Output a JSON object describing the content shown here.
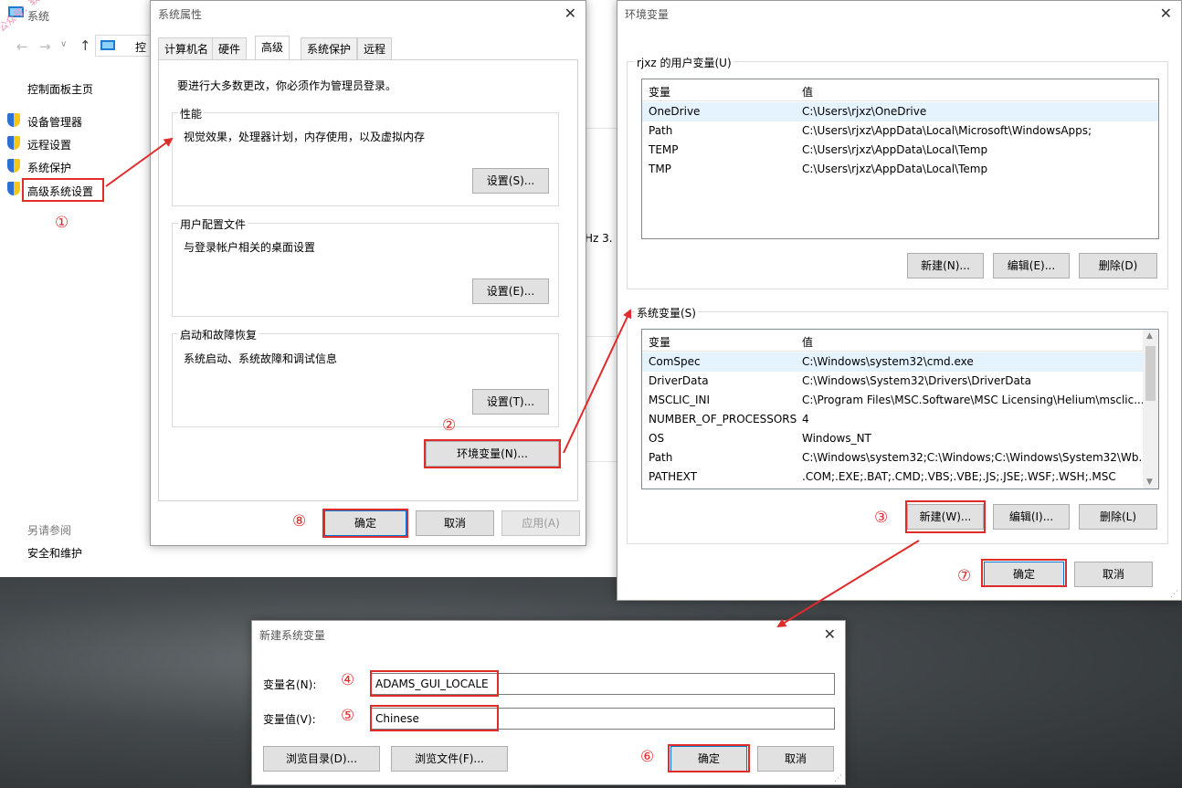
{
  "watermark": "公众号：软件分享",
  "system_window": {
    "title": "系统",
    "address": "控",
    "links": {
      "home": "控制面板主页",
      "device_manager": "设备管理器",
      "remote": "远程设置",
      "protection": "系统保护",
      "advanced": "高级系统设置"
    },
    "see_also": "另请参阅",
    "security": "安全和维护",
    "partial_text": "Hz 3."
  },
  "sys_props": {
    "title": "系统属性",
    "tabs": [
      "计算机名",
      "硬件",
      "高级",
      "系统保护",
      "远程"
    ],
    "admin_note": "要进行大多数更改，你必须作为管理员登录。",
    "perf_label": "性能",
    "perf_desc": "视觉效果，处理器计划，内存使用，以及虚拟内存",
    "perf_btn": "设置(S)...",
    "profile_label": "用户配置文件",
    "profile_desc": "与登录帐户相关的桌面设置",
    "profile_btn": "设置(E)...",
    "startup_label": "启动和故障恢复",
    "startup_desc": "系统启动、系统故障和调试信息",
    "startup_btn": "设置(T)...",
    "env_btn": "环境变量(N)...",
    "ok": "确定",
    "cancel": "取消",
    "apply": "应用(A)"
  },
  "env_vars": {
    "title": "环境变量",
    "user_group": "rjxz 的用户变量(U)",
    "col_var": "变量",
    "col_val": "值",
    "user_rows": [
      {
        "name": "OneDrive",
        "value": "C:\\Users\\rjxz\\OneDrive"
      },
      {
        "name": "Path",
        "value": "C:\\Users\\rjxz\\AppData\\Local\\Microsoft\\WindowsApps;"
      },
      {
        "name": "TEMP",
        "value": "C:\\Users\\rjxz\\AppData\\Local\\Temp"
      },
      {
        "name": "TMP",
        "value": "C:\\Users\\rjxz\\AppData\\Local\\Temp"
      }
    ],
    "user_new": "新建(N)...",
    "user_edit": "编辑(E)...",
    "user_delete": "删除(D)",
    "sys_group": "系统变量(S)",
    "sys_rows": [
      {
        "name": "ComSpec",
        "value": "C:\\Windows\\system32\\cmd.exe"
      },
      {
        "name": "DriverData",
        "value": "C:\\Windows\\System32\\Drivers\\DriverData"
      },
      {
        "name": "MSCLIC_INI",
        "value": "C:\\Program Files\\MSC.Software\\MSC Licensing\\Helium\\msclic..."
      },
      {
        "name": "NUMBER_OF_PROCESSORS",
        "value": "4"
      },
      {
        "name": "OS",
        "value": "Windows_NT"
      },
      {
        "name": "Path",
        "value": "C:\\Windows\\system32;C:\\Windows;C:\\Windows\\System32\\Wb..."
      },
      {
        "name": "PATHEXT",
        "value": ".COM;.EXE;.BAT;.CMD;.VBS;.VBE;.JS;.JSE;.WSF;.WSH;.MSC"
      }
    ],
    "sys_new": "新建(W)...",
    "sys_edit": "编辑(I)...",
    "sys_delete": "删除(L)",
    "ok": "确定",
    "cancel": "取消"
  },
  "new_var": {
    "title": "新建系统变量",
    "name_label": "变量名(N):",
    "name_value": "ADAMS_GUI_LOCALE",
    "value_label": "变量值(V):",
    "value_value": "Chinese",
    "browse_dir": "浏览目录(D)...",
    "browse_file": "浏览文件(F)...",
    "ok": "确定",
    "cancel": "取消"
  },
  "steps": [
    "①",
    "②",
    "③",
    "④",
    "⑤",
    "⑥",
    "⑦",
    "⑧"
  ],
  "colors": {
    "annotation": "#e02b2b",
    "selection": "#e5f3ff",
    "focus": "#0078d7"
  }
}
